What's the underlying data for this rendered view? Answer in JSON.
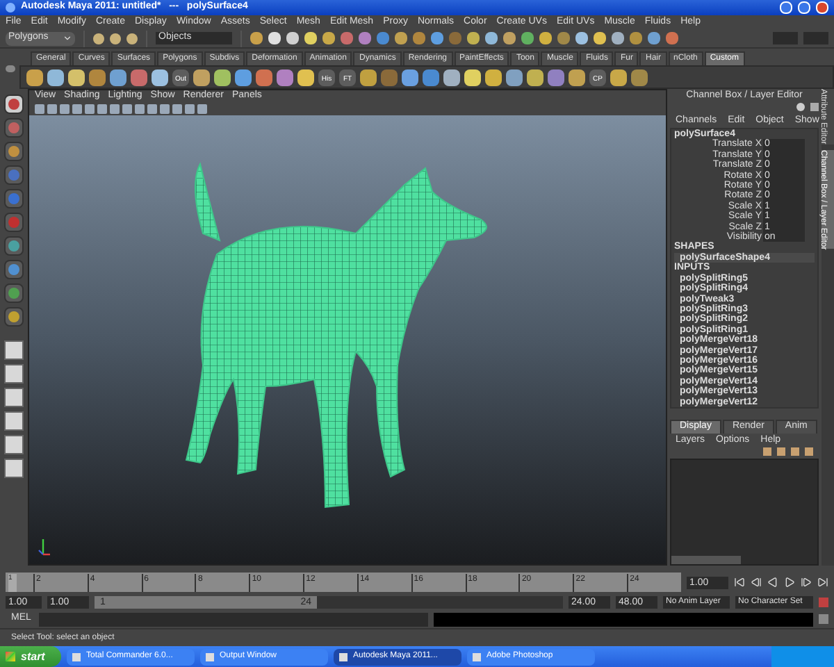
{
  "window": {
    "title": "Autodesk Maya 2011: untitled*   ---   polySurface4"
  },
  "menu": [
    "File",
    "Edit",
    "Modify",
    "Create",
    "Display",
    "Window",
    "Assets",
    "Select",
    "Mesh",
    "Edit Mesh",
    "Proxy",
    "Normals",
    "Color",
    "Create UVs",
    "Edit UVs",
    "Muscle",
    "Fluids",
    "Help"
  ],
  "status_line": {
    "mode": "Polygons",
    "selection_mask": "Objects"
  },
  "shelf": {
    "tabs": [
      {
        "label": "General",
        "selected": false
      },
      {
        "label": "Curves",
        "selected": false
      },
      {
        "label": "Surfaces",
        "selected": false
      },
      {
        "label": "Polygons",
        "selected": false
      },
      {
        "label": "Subdivs",
        "selected": false
      },
      {
        "label": "Deformation",
        "selected": false
      },
      {
        "label": "Animation",
        "selected": false
      },
      {
        "label": "Dynamics",
        "selected": false
      },
      {
        "label": "Rendering",
        "selected": false
      },
      {
        "label": "PaintEffects",
        "selected": false
      },
      {
        "label": "Toon",
        "selected": false
      },
      {
        "label": "Muscle",
        "selected": false
      },
      {
        "label": "Fluids",
        "selected": false
      },
      {
        "label": "Fur",
        "selected": false
      },
      {
        "label": "Hair",
        "selected": false
      },
      {
        "label": "nCloth",
        "selected": false
      },
      {
        "label": "Custom",
        "selected": true
      }
    ],
    "icon_labels": [
      {
        "label": "Out"
      },
      {
        "label": "His"
      },
      {
        "label": "FT"
      },
      {
        "label": "CP"
      }
    ]
  },
  "viewport": {
    "menu": [
      "View",
      "Shading",
      "Lighting",
      "Show",
      "Renderer",
      "Panels"
    ]
  },
  "channel_box": {
    "title": "Channel Box / Layer Editor",
    "menu": [
      "Channels",
      "Edit",
      "Object",
      "Show"
    ],
    "object": "polySurface4",
    "attributes": [
      {
        "name": "Translate X",
        "value": "0"
      },
      {
        "name": "Translate Y",
        "value": "0"
      },
      {
        "name": "Translate Z",
        "value": "0"
      },
      {
        "name": "Rotate X",
        "value": "0"
      },
      {
        "name": "Rotate Y",
        "value": "0"
      },
      {
        "name": "Rotate Z",
        "value": "0"
      },
      {
        "name": "Scale X",
        "value": "1"
      },
      {
        "name": "Scale Y",
        "value": "1"
      },
      {
        "name": "Scale Z",
        "value": "1"
      },
      {
        "name": "Visibility",
        "value": "on"
      }
    ],
    "shapes_heading": "SHAPES",
    "shapes": [
      "polySurfaceShape4"
    ],
    "inputs_heading": "INPUTS",
    "inputs": [
      "polySplitRing5",
      "polySplitRing4",
      "polyTweak3",
      "polySplitRing3",
      "polySplitRing2",
      "polySplitRing1",
      "polyMergeVert18",
      "polyMergeVert17",
      "polyMergeVert16",
      "polyMergeVert15",
      "polyMergeVert14",
      "polyMergeVert13",
      "polyMergeVert12"
    ]
  },
  "layer_editor": {
    "tabs": [
      {
        "label": "Display",
        "selected": true
      },
      {
        "label": "Render",
        "selected": false
      },
      {
        "label": "Anim",
        "selected": false
      }
    ],
    "menu": [
      "Layers",
      "Options",
      "Help"
    ]
  },
  "side_tabs": [
    {
      "label": "Attribute Editor",
      "selected": false
    },
    {
      "label": "Channel Box / Layer Editor",
      "selected": true
    }
  ],
  "time_slider": {
    "ticks": [
      "2",
      "4",
      "6",
      "8",
      "10",
      "12",
      "14",
      "16",
      "18",
      "20",
      "22",
      "24"
    ],
    "current_marker": "1",
    "level": 0,
    "current_frame": "1.00"
  },
  "range_slider": {
    "start": "1.00",
    "playback_start": "1.00",
    "range_start": "1",
    "range_end": "24",
    "playback_end": "24.00",
    "end": "48.00",
    "anim_layer": "No Anim Layer",
    "character_set": "No Character Set"
  },
  "command_line": {
    "label": "MEL"
  },
  "help_line": "Select Tool: select an object",
  "taskbar": {
    "start": "start",
    "items": [
      {
        "label": "Total Commander 6.0...",
        "selected": false
      },
      {
        "label": "Output Window",
        "selected": false
      },
      {
        "label": "Autodesk Maya 2011...",
        "selected": true
      },
      {
        "label": "Adobe Photoshop",
        "selected": false
      }
    ]
  }
}
